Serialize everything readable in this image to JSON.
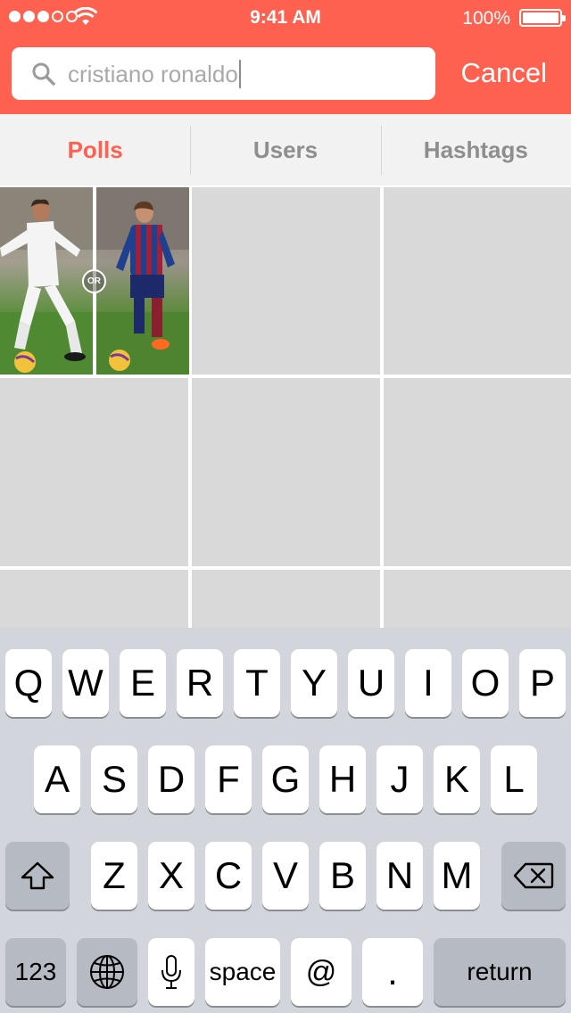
{
  "status_bar": {
    "time": "9:41 AM",
    "battery": "100%",
    "signal_bars_filled": 3,
    "signal_bars_total": 5
  },
  "search": {
    "value": "cristiano ronaldo",
    "cancel_label": "Cancel",
    "icon": "search-icon"
  },
  "tabs": [
    {
      "label": "Polls",
      "active": true
    },
    {
      "label": "Users",
      "active": false
    },
    {
      "label": "Hashtags",
      "active": false
    }
  ],
  "results": {
    "first_poll_badge": "OR"
  },
  "keyboard": {
    "row1": [
      "Q",
      "W",
      "E",
      "R",
      "T",
      "Y",
      "U",
      "I",
      "O",
      "P"
    ],
    "row2": [
      "A",
      "S",
      "D",
      "F",
      "G",
      "H",
      "J",
      "K",
      "L"
    ],
    "row3": [
      "Z",
      "X",
      "C",
      "V",
      "B",
      "N",
      "M"
    ],
    "numbers_label": "123",
    "space_label": "space",
    "at_label": "@",
    "period_label": ".",
    "return_label": "return",
    "icons": {
      "shift": "shift-icon",
      "backspace": "backspace-icon",
      "globe": "globe-icon",
      "mic": "microphone-icon"
    }
  },
  "colors": {
    "accent": "#fe6150",
    "tab_inactive": "#8e8e8e",
    "placeholder_cell": "#d9d9d9",
    "keyboard_bg": "#d2d5db"
  }
}
